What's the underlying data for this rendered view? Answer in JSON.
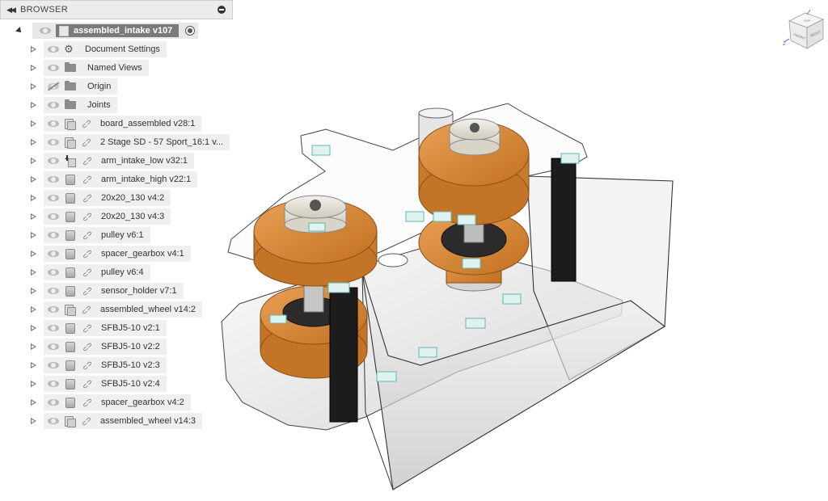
{
  "browser": {
    "header_title": "BROWSER",
    "collapse_icon": "double-left-arrow-icon",
    "root": {
      "label": "assembled_intake v107"
    },
    "items": [
      {
        "label": "Document Settings",
        "icon": "gear-icon"
      },
      {
        "label": "Named Views",
        "icon": "folder-icon"
      },
      {
        "label": "Origin",
        "icon": "folder-icon",
        "hidden": true
      },
      {
        "label": "Joints",
        "icon": "folder-icon"
      },
      {
        "label": "board_assembled v28:1",
        "icon": "component-icon"
      },
      {
        "label": "2 Stage SD - 57 Sport_16:1 v...",
        "icon": "component-icon"
      },
      {
        "label": "arm_intake_low v32:1",
        "icon": "activate-arrow-icon"
      },
      {
        "label": "arm_intake_high v22:1",
        "icon": "body-icon"
      },
      {
        "label": "20x20_130 v4:2",
        "icon": "body-icon"
      },
      {
        "label": "20x20_130 v4:3",
        "icon": "body-icon"
      },
      {
        "label": "pulley v6:1",
        "icon": "body-icon"
      },
      {
        "label": "spacer_gearbox v4:1",
        "icon": "body-icon"
      },
      {
        "label": "pulley v6:4",
        "icon": "body-icon"
      },
      {
        "label": "sensor_holder v7:1",
        "icon": "body-icon"
      },
      {
        "label": "assembled_wheel v14:2",
        "icon": "component-icon"
      },
      {
        "label": "SFBJ5-10 v2:1",
        "icon": "body-icon"
      },
      {
        "label": "SFBJ5-10 v2:2",
        "icon": "body-icon"
      },
      {
        "label": "SFBJ5-10 v2:3",
        "icon": "body-icon"
      },
      {
        "label": "SFBJ5-10 v2:4",
        "icon": "body-icon"
      },
      {
        "label": "spacer_gearbox v4:2",
        "icon": "body-icon"
      },
      {
        "label": "assembled_wheel v14:3",
        "icon": "component-icon"
      }
    ]
  },
  "viewcube": {
    "top": "TOP",
    "front": "FRONT",
    "right": "RIGHT",
    "axis_z": "Z"
  },
  "colors": {
    "wheel_orange": "#d98a3a",
    "wheel_dark": "#b8691e",
    "plate_fill": "#f2f2f2",
    "joint_teal": "#5fb8b0",
    "extrusion_black": "#1c1c1c"
  }
}
